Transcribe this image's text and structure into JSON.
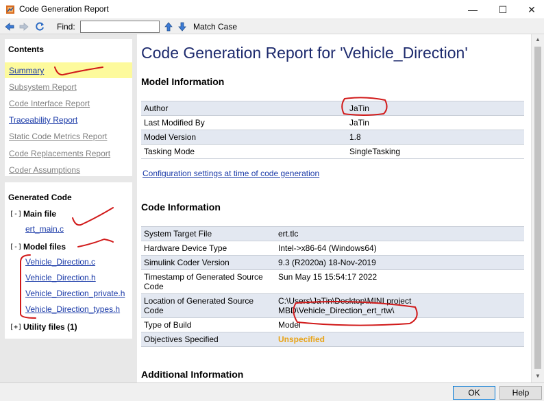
{
  "window": {
    "title": "Code Generation Report",
    "minimize": "—",
    "maximize": "☐",
    "close": "✕"
  },
  "toolbar": {
    "find_label": "Find:",
    "find_value": "",
    "match_case_label": "Match Case"
  },
  "contents": {
    "heading": "Contents",
    "items": [
      {
        "label": "Summary"
      },
      {
        "label": "Subsystem Report"
      },
      {
        "label": "Code Interface Report"
      },
      {
        "label": "Traceability Report"
      },
      {
        "label": "Static Code Metrics Report"
      },
      {
        "label": "Code Replacements Report"
      },
      {
        "label": "Coder Assumptions"
      }
    ]
  },
  "generated_code": {
    "heading": "Generated Code",
    "main_file": {
      "toggle": "[-]",
      "label": "Main file",
      "files": [
        "ert_main.c"
      ]
    },
    "model_files": {
      "toggle": "[-]",
      "label": "Model files",
      "files": [
        "Vehicle_Direction.c",
        "Vehicle_Direction.h",
        "Vehicle_Direction_private.h",
        "Vehicle_Direction_types.h"
      ]
    },
    "utility_files": {
      "toggle": "[+]",
      "label": "Utility files (1)"
    }
  },
  "report": {
    "title": "Code Generation Report for 'Vehicle_Direction'",
    "model_info": {
      "heading": "Model Information",
      "rows": [
        {
          "key": "Author",
          "value": "JaTin"
        },
        {
          "key": "Last Modified By",
          "value": "JaTin"
        },
        {
          "key": "Model Version",
          "value": "1.8"
        },
        {
          "key": "Tasking Mode",
          "value": "SingleTasking"
        }
      ]
    },
    "config_link": "Configuration settings at time of code generation",
    "code_info": {
      "heading": "Code Information",
      "rows": [
        {
          "key": "System Target File",
          "value": "ert.tlc"
        },
        {
          "key": "Hardware Device Type",
          "value": "Intel->x86-64 (Windows64)"
        },
        {
          "key": "Simulink Coder Version",
          "value": "9.3 (R2020a) 18-Nov-2019"
        },
        {
          "key": "Timestamp of Generated Source Code",
          "value": "Sun May 15 15:54:17 2022"
        },
        {
          "key": "Location of Generated Source Code",
          "value": "C:\\Users\\JaTin\\Desktop\\MINI project MBD\\Vehicle_Direction_ert_rtw\\"
        },
        {
          "key": "Type of Build",
          "value": "Model"
        },
        {
          "key": "Objectives Specified",
          "value": "Unspecified"
        }
      ]
    },
    "additional_heading": "Additional Information"
  },
  "footer": {
    "ok_label": "OK",
    "help_label": "Help"
  },
  "colors": {
    "title_color": "#1d2a6d",
    "link_color": "#1a3aa8",
    "highlight": "#fdfa9c",
    "row_shade": "#e3e8f1",
    "unspecified": "#e8a317",
    "annotation_ink": "#d11a1a"
  },
  "icons": {
    "app": "report-app-icon",
    "back": "back-arrow-icon",
    "forward": "forward-arrow-icon",
    "refresh": "refresh-icon",
    "find_prev": "up-arrow-icon",
    "find_next": "down-arrow-icon"
  }
}
